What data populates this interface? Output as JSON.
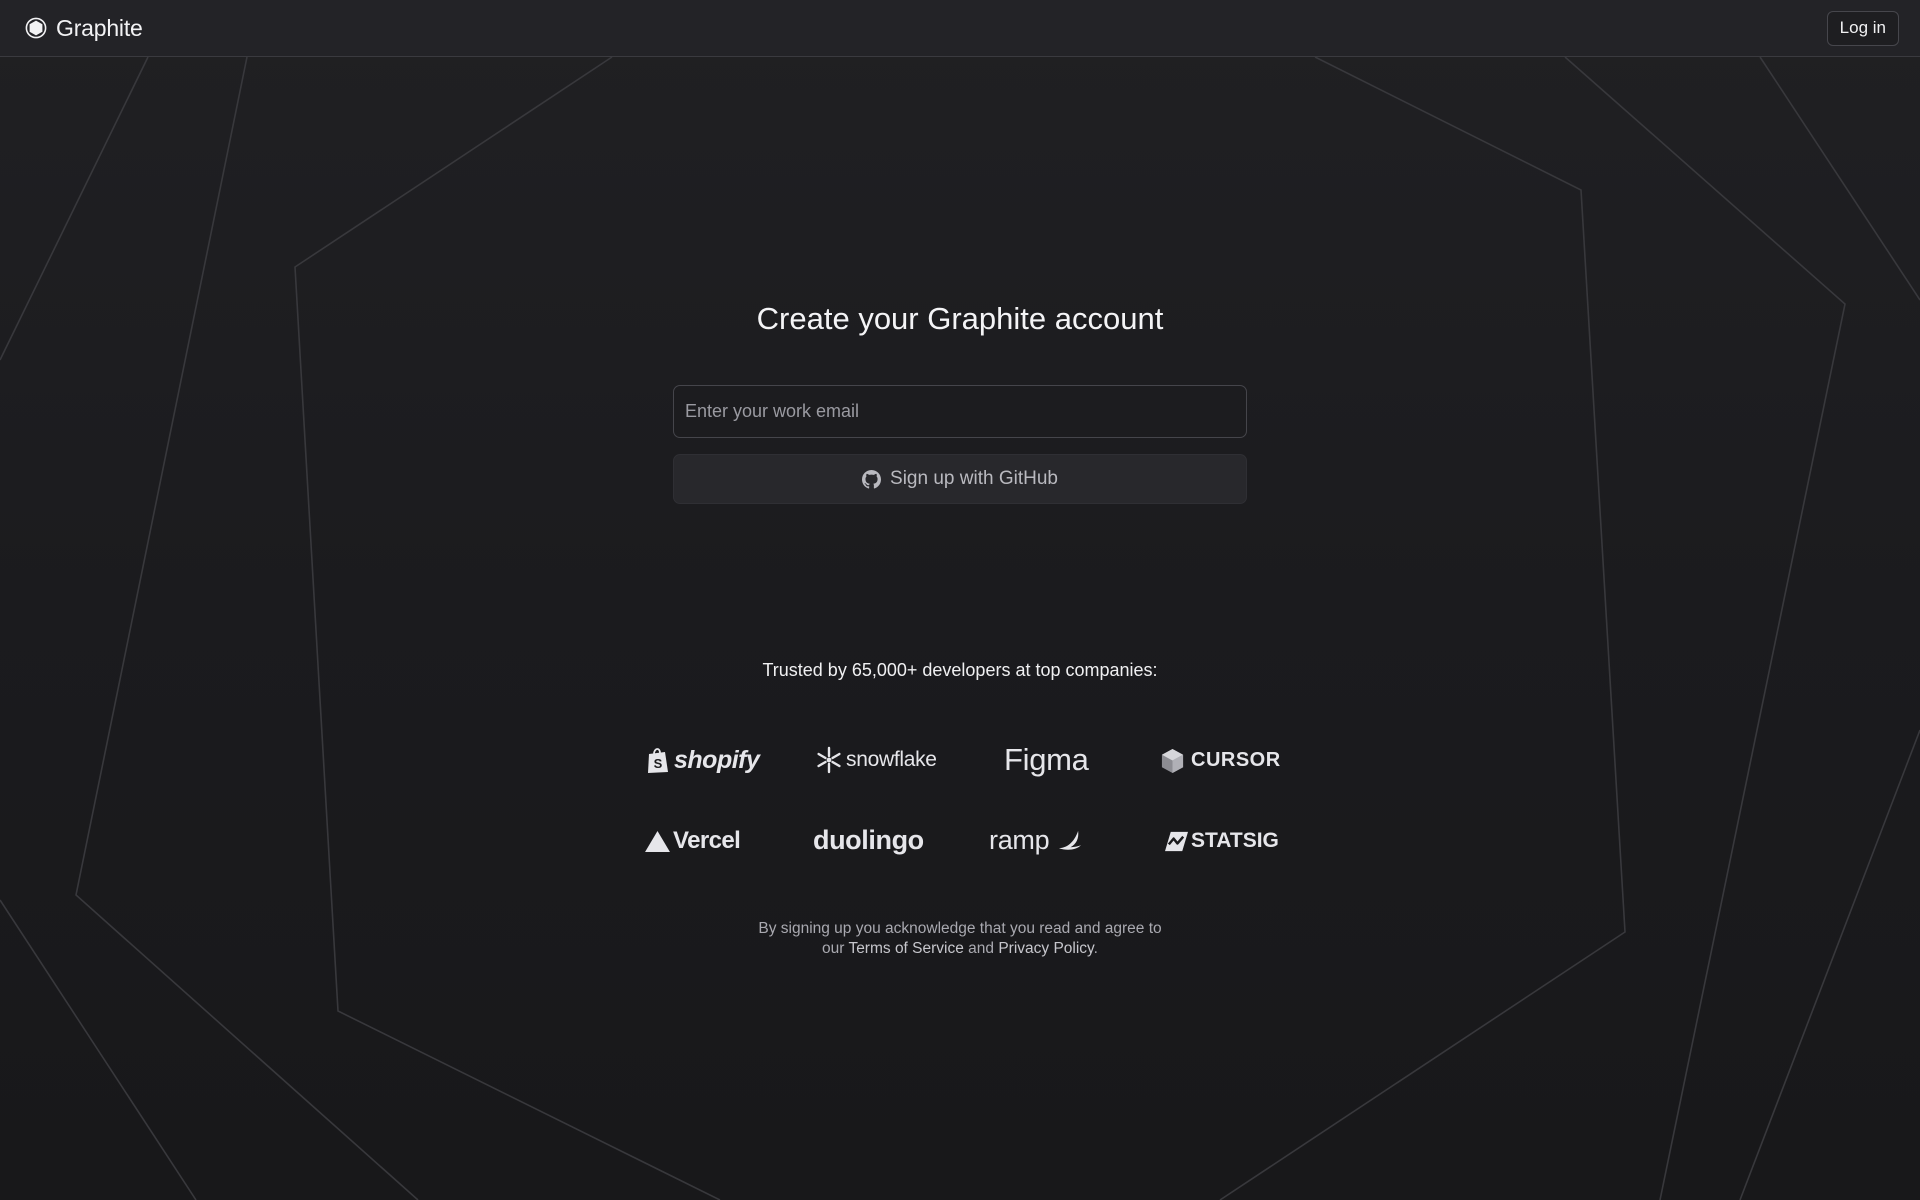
{
  "header": {
    "brand_name": "Graphite",
    "login_label": "Log in"
  },
  "main": {
    "heading": "Create your Graphite account",
    "email_placeholder": "Enter your work email",
    "github_button_label": "Sign up with GitHub",
    "trusted_text": "Trusted by 65,000+ developers at top companies:",
    "logos": [
      {
        "name": "shopify",
        "text": "shopify",
        "icon": "shopify-bag-icon"
      },
      {
        "name": "snowflake",
        "text": "snowflake",
        "icon": "snowflake-icon"
      },
      {
        "name": "figma",
        "text": "Figma",
        "icon": ""
      },
      {
        "name": "cursor",
        "text": "CURSOR",
        "icon": "cursor-cube-icon"
      },
      {
        "name": "vercel",
        "text": "Vercel",
        "icon": "vercel-triangle-icon"
      },
      {
        "name": "duolingo",
        "text": "duolingo",
        "icon": ""
      },
      {
        "name": "ramp",
        "text": "ramp",
        "icon": "ramp-wing-icon"
      },
      {
        "name": "statsig",
        "text": "STATSIG",
        "icon": "statsig-icon"
      }
    ],
    "legal": {
      "line1": "By signing up you acknowledge that you read and agree to",
      "prefix2": "our ",
      "terms": "Terms of Service",
      "and": " and ",
      "privacy": "Privacy Policy",
      "suffix": "."
    }
  },
  "colors": {
    "background": "#1b1b1d",
    "topbar": "#232327",
    "text": "#ececef",
    "muted": "#a9a9b0",
    "button": "#28282c",
    "bg_lines": "#3a3a3e"
  }
}
